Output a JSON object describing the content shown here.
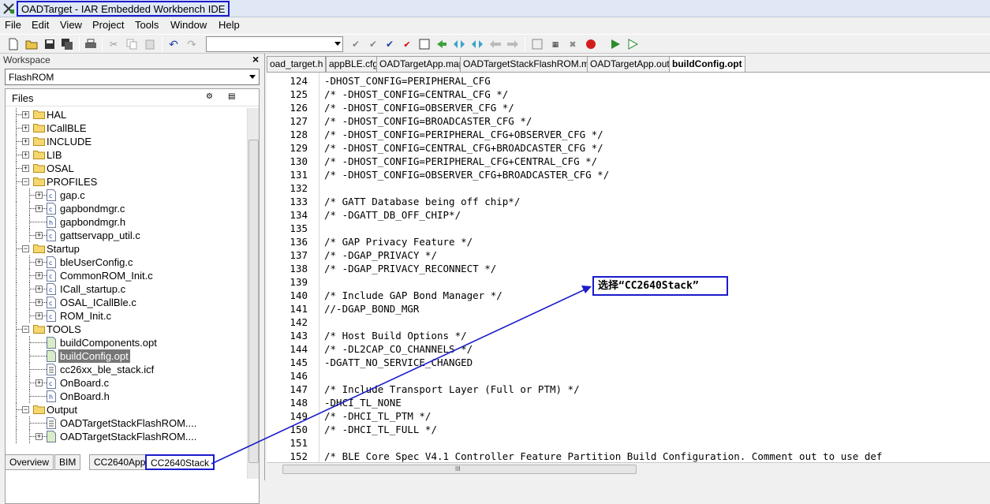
{
  "window": {
    "title": "OADTarget - IAR Embedded Workbench IDE"
  },
  "menu": [
    "File",
    "Edit",
    "View",
    "Project",
    "Tools",
    "Window",
    "Help"
  ],
  "workspace": {
    "header": "Workspace",
    "close": "×",
    "configuration": "FlashROM",
    "files_label": "Files",
    "tree": [
      {
        "label": "HAL",
        "kind": "folder",
        "level": 0,
        "expander": "+"
      },
      {
        "label": "ICallBLE",
        "kind": "folder",
        "level": 0,
        "expander": "+"
      },
      {
        "label": "INCLUDE",
        "kind": "folder",
        "level": 0,
        "expander": "+"
      },
      {
        "label": "LIB",
        "kind": "folder",
        "level": 0,
        "expander": "+"
      },
      {
        "label": "OSAL",
        "kind": "folder",
        "level": 0,
        "expander": "+"
      },
      {
        "label": "PROFILES",
        "kind": "folder",
        "level": 0,
        "expander": "−"
      },
      {
        "label": "gap.c",
        "kind": "cfile",
        "level": 1,
        "expander": "+"
      },
      {
        "label": "gapbondmgr.c",
        "kind": "cfile",
        "level": 1,
        "expander": "+"
      },
      {
        "label": "gapbondmgr.h",
        "kind": "hfile",
        "level": 1,
        "expander": ""
      },
      {
        "label": "gattservapp_util.c",
        "kind": "cfile",
        "level": 1,
        "expander": "+"
      },
      {
        "label": "Startup",
        "kind": "folder",
        "level": 0,
        "expander": "−"
      },
      {
        "label": "bleUserConfig.c",
        "kind": "cfile",
        "level": 1,
        "expander": "+"
      },
      {
        "label": "CommonROM_Init.c",
        "kind": "cfile",
        "level": 1,
        "expander": "+"
      },
      {
        "label": "ICall_startup.c",
        "kind": "cfile",
        "level": 1,
        "expander": "+"
      },
      {
        "label": "OSAL_ICallBle.c",
        "kind": "cfile",
        "level": 1,
        "expander": "+"
      },
      {
        "label": "ROM_Init.c",
        "kind": "cfile",
        "level": 1,
        "expander": "+"
      },
      {
        "label": "TOOLS",
        "kind": "folder",
        "level": 0,
        "expander": "−"
      },
      {
        "label": "buildComponents.opt",
        "kind": "optfile",
        "level": 1,
        "expander": ""
      },
      {
        "label": "buildConfig.opt",
        "kind": "optfile",
        "level": 1,
        "expander": "",
        "selected": true
      },
      {
        "label": "cc26xx_ble_stack.icf",
        "kind": "docfile",
        "level": 1,
        "expander": ""
      },
      {
        "label": "OnBoard.c",
        "kind": "cfile",
        "level": 1,
        "expander": "+"
      },
      {
        "label": "OnBoard.h",
        "kind": "hfile",
        "level": 1,
        "expander": ""
      },
      {
        "label": "Output",
        "kind": "folder",
        "level": 0,
        "expander": "−"
      },
      {
        "label": "OADTargetStackFlashROM....",
        "kind": "docfile",
        "level": 1,
        "expander": ""
      },
      {
        "label": "OADTargetStackFlashROM....",
        "kind": "optfile",
        "level": 1,
        "expander": "+"
      }
    ],
    "tabs": [
      {
        "label": "Overview",
        "active": false
      },
      {
        "label": "BIM",
        "active": false
      },
      {
        "label": "CC2640App",
        "active": false
      },
      {
        "label": "CC2640Stack",
        "active": true
      }
    ]
  },
  "editor": {
    "tabs": [
      {
        "label": "oad_target.h",
        "active": false
      },
      {
        "label": "appBLE.cfg",
        "active": false
      },
      {
        "label": "OADTargetApp.map",
        "active": false
      },
      {
        "label": "OADTargetStackFlashROM.map",
        "active": false
      },
      {
        "label": "OADTargetApp.out",
        "active": false
      },
      {
        "label": "buildConfig.opt",
        "active": true
      }
    ],
    "lines": [
      {
        "n": "124",
        "t": "-DHOST_CONFIG=PERIPHERAL_CFG"
      },
      {
        "n": "125",
        "t": "/* -DHOST_CONFIG=CENTRAL_CFG */"
      },
      {
        "n": "126",
        "t": "/* -DHOST_CONFIG=OBSERVER_CFG */"
      },
      {
        "n": "127",
        "t": "/* -DHOST_CONFIG=BROADCASTER_CFG */"
      },
      {
        "n": "128",
        "t": "/* -DHOST_CONFIG=PERIPHERAL_CFG+OBSERVER_CFG */"
      },
      {
        "n": "129",
        "t": "/* -DHOST_CONFIG=CENTRAL_CFG+BROADCASTER_CFG */"
      },
      {
        "n": "130",
        "t": "/* -DHOST_CONFIG=PERIPHERAL_CFG+CENTRAL_CFG */"
      },
      {
        "n": "131",
        "t": "/* -DHOST_CONFIG=OBSERVER_CFG+BROADCASTER_CFG */"
      },
      {
        "n": "132",
        "t": ""
      },
      {
        "n": "133",
        "t": "/* GATT Database being off chip*/"
      },
      {
        "n": "134",
        "t": "/* -DGATT_DB_OFF_CHIP*/"
      },
      {
        "n": "135",
        "t": ""
      },
      {
        "n": "136",
        "t": "/* GAP Privacy Feature */"
      },
      {
        "n": "137",
        "t": "/* -DGAP_PRIVACY */"
      },
      {
        "n": "138",
        "t": "/* -DGAP_PRIVACY_RECONNECT */"
      },
      {
        "n": "139",
        "t": ""
      },
      {
        "n": "140",
        "t": "/* Include GAP Bond Manager */"
      },
      {
        "n": "141",
        "t": "//-DGAP_BOND_MGR"
      },
      {
        "n": "142",
        "t": ""
      },
      {
        "n": "143",
        "t": "/* Host Build Options */"
      },
      {
        "n": "144",
        "t": "/* -DL2CAP_CO_CHANNELS */"
      },
      {
        "n": "145",
        "t": "-DGATT_NO_SERVICE_CHANGED"
      },
      {
        "n": "146",
        "t": ""
      },
      {
        "n": "147",
        "t": "/* Include Transport Layer (Full or PTM) */"
      },
      {
        "n": "148",
        "t": "-DHCI_TL_NONE"
      },
      {
        "n": "149",
        "t": "/* -DHCI_TL_PTM */"
      },
      {
        "n": "150",
        "t": "/* -DHCI_TL_FULL */"
      },
      {
        "n": "151",
        "t": ""
      },
      {
        "n": "152",
        "t": "/* BLE Core Spec V4.1 Controller Feature Partition Build Configuration. Comment out to use def"
      }
    ]
  },
  "annotation": {
    "text": "选择“CC2640Stack”",
    "color": "#1b1bcc"
  }
}
